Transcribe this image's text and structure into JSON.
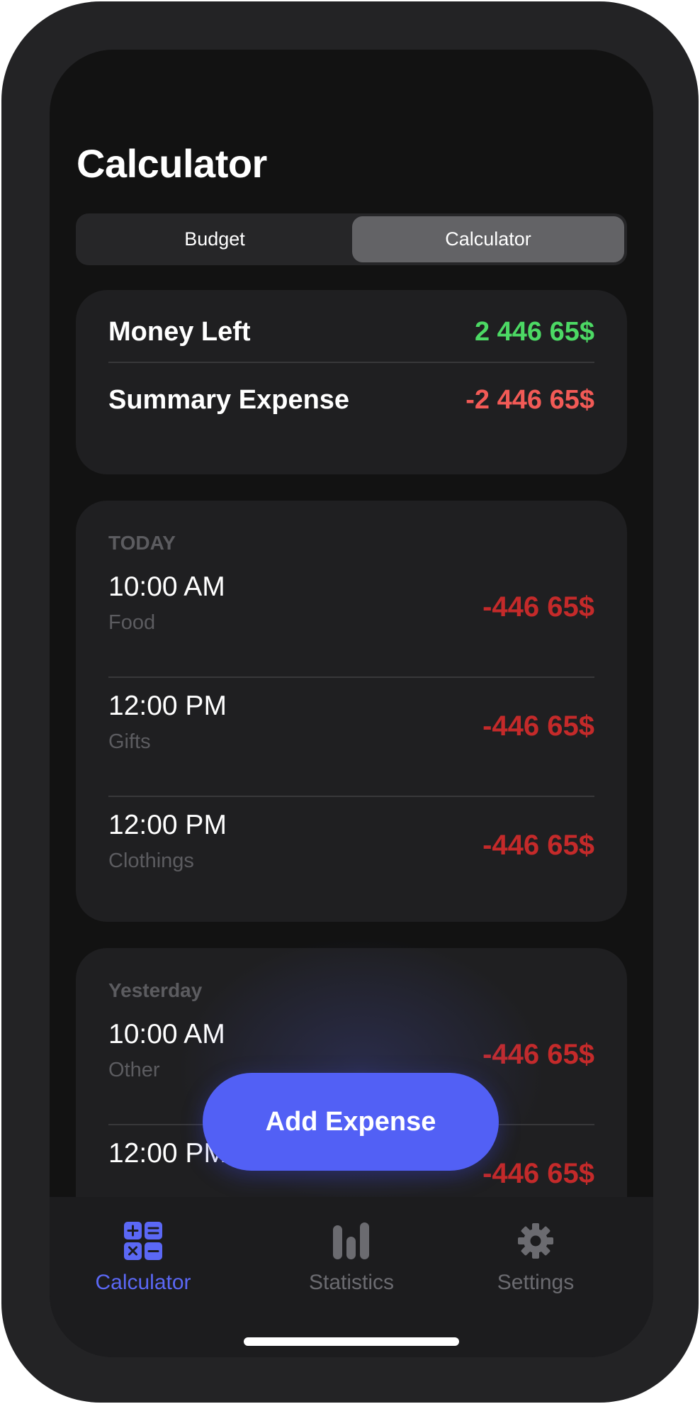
{
  "title": "Calculator",
  "segments": {
    "left": "Budget",
    "right": "Calculator",
    "selected": "Calculator"
  },
  "summary": {
    "money_left_label": "Money Left",
    "money_left_value": "2 446 65$",
    "expense_label": "Summary Expense",
    "expense_value": "-2 446 65$"
  },
  "today": {
    "header": "TODAY",
    "items": [
      {
        "time": "10:00 AM",
        "category": "Food",
        "amount": "-446 65$"
      },
      {
        "time": "12:00 PM",
        "category": "Gifts",
        "amount": "-446 65$"
      },
      {
        "time": "12:00 PM",
        "category": "Clothings",
        "amount": "-446 65$"
      }
    ]
  },
  "yesterday": {
    "header": "Yesterday",
    "items": [
      {
        "time": "10:00 AM",
        "category": "Other",
        "amount": "-446 65$"
      },
      {
        "time": "12:00 PM",
        "category": "",
        "amount": "-446 65$"
      }
    ]
  },
  "fab_label": "Add Expense",
  "tabs": [
    {
      "label": "Calculator",
      "icon": "calculator-icon",
      "active": true
    },
    {
      "label": "Statistics",
      "icon": "bar-chart-icon",
      "active": false
    },
    {
      "label": "Settings",
      "icon": "gear-icon",
      "active": false
    }
  ],
  "colors": {
    "accent": "#5260f5",
    "positive": "#4cd964",
    "negative": "#f25a56",
    "expense": "#c42a2a"
  }
}
